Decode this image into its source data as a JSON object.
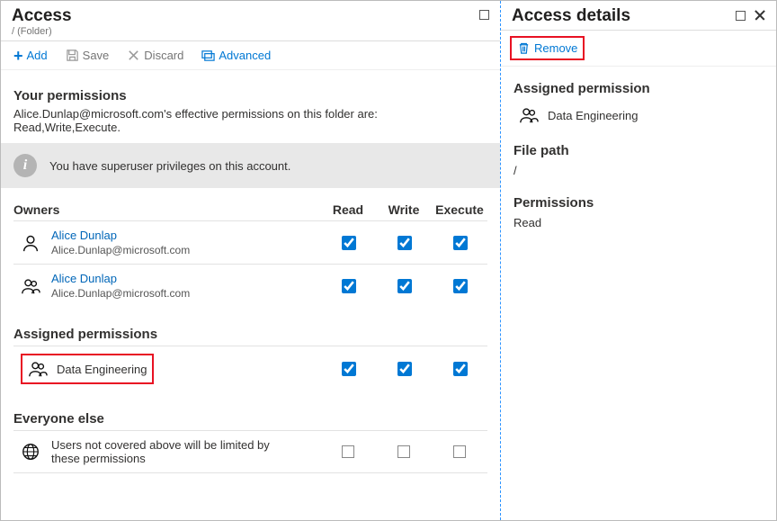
{
  "left": {
    "title": "Access",
    "subtitle": "/ (Folder)",
    "toolbar": {
      "add": "Add",
      "save": "Save",
      "discard": "Discard",
      "advanced": "Advanced"
    },
    "yourPermissions": {
      "heading": "Your permissions",
      "description": "Alice.Dunlap@microsoft.com's effective permissions on this folder are: Read,Write,Execute.",
      "info": "You have superuser privileges on this account."
    },
    "columns": {
      "principal": "Owners",
      "read": "Read",
      "write": "Write",
      "execute": "Execute"
    },
    "owners": [
      {
        "name": "Alice Dunlap",
        "email": "Alice.Dunlap@microsoft.com",
        "type": "user",
        "read": true,
        "write": true,
        "execute": true
      },
      {
        "name": "Alice Dunlap",
        "email": "Alice.Dunlap@microsoft.com",
        "type": "group",
        "read": true,
        "write": true,
        "execute": true
      }
    ],
    "assignedHeading": "Assigned permissions",
    "assigned": {
      "name": "Data Engineering",
      "read": true,
      "write": true,
      "execute": true
    },
    "everyone": {
      "heading": "Everyone else",
      "text": "Users not covered above will be limited by these permissions",
      "read": false,
      "write": false,
      "execute": false
    }
  },
  "right": {
    "title": "Access details",
    "toolbar": {
      "remove": "Remove"
    },
    "assignedHeading": "Assigned permission",
    "assignedGroup": "Data Engineering",
    "filePathHeading": "File path",
    "filePathValue": "/",
    "permissionsHeading": "Permissions",
    "permissionsValue": "Read"
  }
}
